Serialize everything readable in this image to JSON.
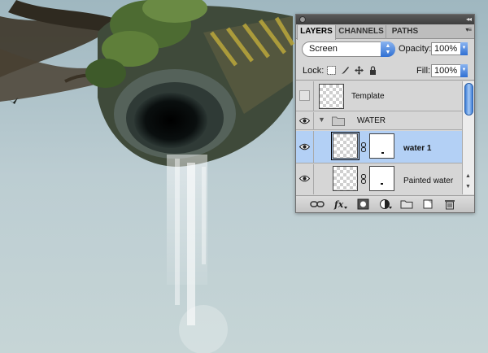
{
  "colors": {
    "sky": "#b9cbd1",
    "panel": "#d6d6d6",
    "selection": "#b3d0f5",
    "accent_blue": "#2f6fd3"
  },
  "panel": {
    "tabs": [
      {
        "label": "LAYERS",
        "active": true
      },
      {
        "label": "CHANNELS",
        "active": false
      },
      {
        "label": "PATHS",
        "active": false
      }
    ],
    "blend_mode": "Screen",
    "opacity_label": "Opacity:",
    "opacity_value": "100%",
    "lock_label": "Lock:",
    "fill_label": "Fill:",
    "fill_value": "100%",
    "layers": [
      {
        "name": "Template",
        "visible": false,
        "type": "layer"
      },
      {
        "name": "WATER",
        "visible": true,
        "type": "group",
        "expanded": true
      },
      {
        "name": "water 1",
        "visible": true,
        "type": "layer-with-mask",
        "selected": true
      },
      {
        "name": "Painted water",
        "visible": true,
        "type": "layer-with-mask",
        "selected": false
      }
    ],
    "footer_icons": [
      "link-layers-icon",
      "layer-style-icon",
      "add-mask-icon",
      "adjustment-layer-icon",
      "new-group-icon",
      "new-layer-icon",
      "trash-icon"
    ]
  }
}
